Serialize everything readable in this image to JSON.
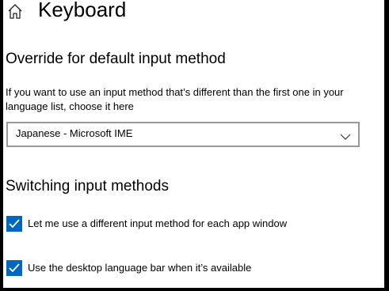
{
  "header": {
    "title": "Keyboard",
    "home_icon": "home-icon"
  },
  "override": {
    "heading": "Override for default input method",
    "description": "If you want to use an input method that’s different than the first one in your language list, choose it here",
    "dropdown_value": "Japanese - Microsoft IME"
  },
  "switching": {
    "heading": "Switching input methods",
    "options": [
      {
        "label": "Let me use a different input method for each app window",
        "checked": true
      },
      {
        "label": "Use the desktop language bar when it’s available",
        "checked": true
      }
    ]
  },
  "colors": {
    "accent": "#0067c0",
    "frame": "#000000"
  }
}
